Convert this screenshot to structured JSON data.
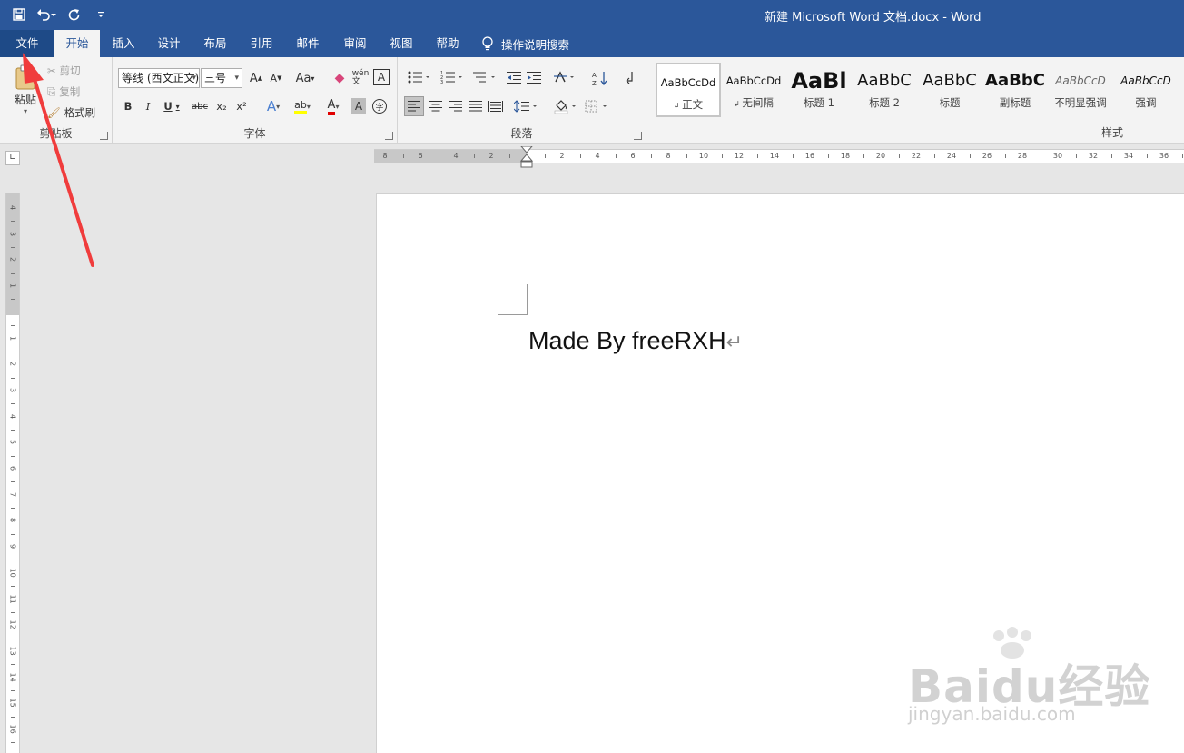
{
  "window": {
    "title": "新建 Microsoft Word 文档.docx  -  Word"
  },
  "tabs": {
    "file": "文件",
    "home": "开始",
    "insert": "插入",
    "design": "设计",
    "layout": "布局",
    "references": "引用",
    "mailings": "邮件",
    "review": "审阅",
    "view": "视图",
    "help": "帮助",
    "tell_me": "操作说明搜索"
  },
  "clipboard": {
    "paste": "粘贴",
    "cut": "剪切",
    "copy": "复制",
    "format_painter": "格式刷",
    "label": "剪贴板"
  },
  "font": {
    "name": "等线 (西文正文)",
    "size": "三号",
    "grow": "A",
    "shrink": "A",
    "case": "Aa",
    "bold": "B",
    "italic": "I",
    "underline": "U",
    "strike": "abc",
    "sub": "x₂",
    "sup": "x²",
    "label": "字体"
  },
  "paragraph": {
    "label": "段落"
  },
  "styles": {
    "label": "样式",
    "items": [
      {
        "preview": "AaBbCcDd",
        "name": "正文"
      },
      {
        "preview": "AaBbCcDd",
        "name": "无间隔"
      },
      {
        "preview": "AaBl",
        "name": "标题 1"
      },
      {
        "preview": "AaBbC",
        "name": "标题 2"
      },
      {
        "preview": "AaBbC",
        "name": "标题"
      },
      {
        "preview": "AaBbC",
        "name": "副标题"
      },
      {
        "preview": "AaBbCcD",
        "name": "不明显强调"
      },
      {
        "preview": "AaBbCcD",
        "name": "强调"
      }
    ]
  },
  "ruler": {
    "h_labels": [
      "8",
      "6",
      "4",
      "2",
      "",
      "2",
      "4",
      "6",
      "8",
      "10",
      "12",
      "14",
      "16",
      "18",
      "20",
      "22",
      "24",
      "26",
      "28",
      "30",
      "32",
      "34",
      "36"
    ],
    "v_labels": [
      "4",
      "3",
      "2",
      "1",
      "",
      "1",
      "2",
      "3",
      "4",
      "5",
      "6",
      "7",
      "8",
      "9",
      "10",
      "11",
      "12",
      "13",
      "14",
      "15",
      "16"
    ]
  },
  "document": {
    "text": "Made By freeRXH",
    "paragraph_mark": "↵"
  },
  "watermark": {
    "brand": "Baidu经验",
    "site": "jingyan.baidu.com"
  },
  "colors": {
    "title_bar": "#2b579a",
    "ribbon": "#f3f3f3",
    "annotation_arrow": "#f03c3c",
    "font_color": "#e00000",
    "highlight": "#ffff00"
  }
}
